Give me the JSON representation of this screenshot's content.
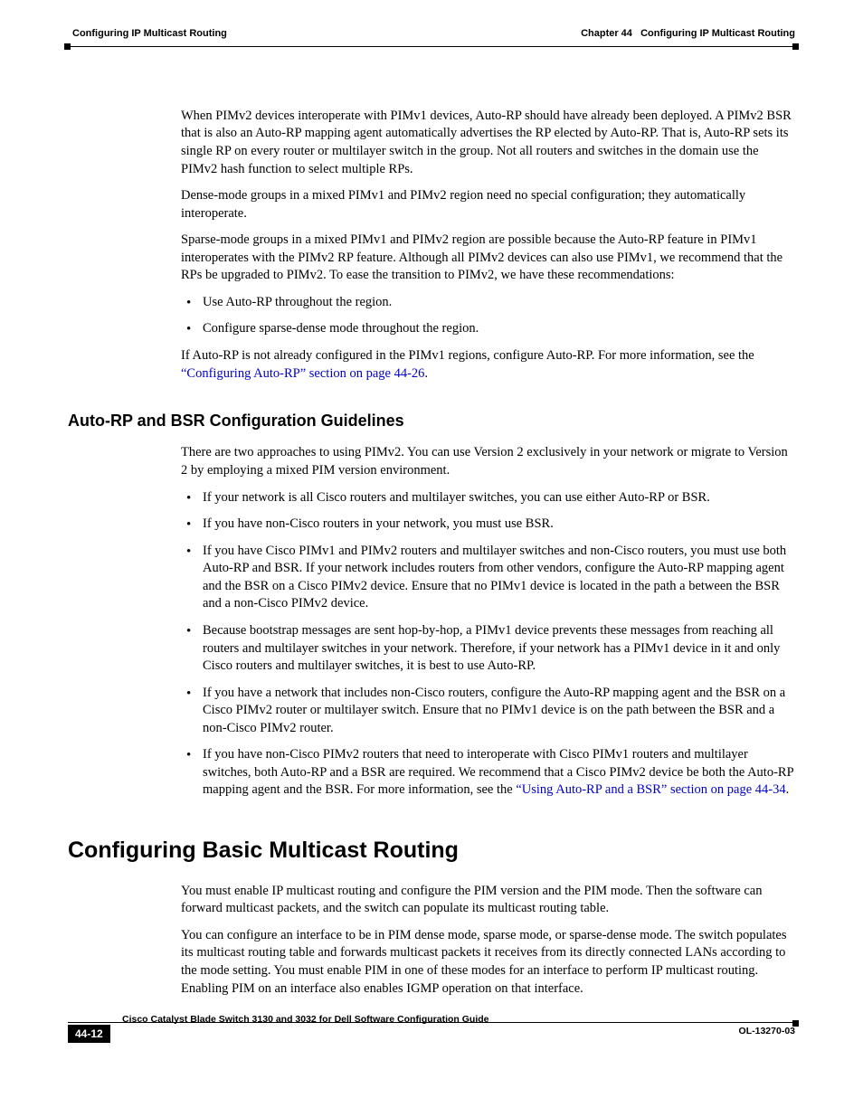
{
  "header": {
    "chapter_label": "Chapter 44",
    "chapter_title": "Configuring IP Multicast Routing",
    "section_running": "Configuring IP Multicast Routing"
  },
  "content": {
    "p1": "When PIMv2 devices interoperate with PIMv1 devices, Auto-RP should have already been deployed. A PIMv2 BSR that is also an Auto-RP mapping agent automatically advertises the RP elected by Auto-RP. That is, Auto-RP sets its single RP on every router or multilayer switch in the group. Not all routers and switches in the domain use the PIMv2 hash function to select multiple RPs.",
    "p2": "Dense-mode groups in a mixed PIMv1 and PIMv2 region need no special configuration; they automatically interoperate.",
    "p3": "Sparse-mode groups in a mixed PIMv1 and PIMv2 region are possible because the Auto-RP feature in PIMv1 interoperates with the PIMv2 RP feature. Although all PIMv2 devices can also use PIMv1, we recommend that the RPs be upgraded to PIMv2. To ease the transition to PIMv2, we have these recommendations:",
    "bullets1": [
      "Use Auto-RP throughout the region.",
      "Configure sparse-dense mode throughout the region."
    ],
    "p4_pre": "If Auto-RP is not already configured in the PIMv1 regions, configure Auto-RP. For more information, see the ",
    "p4_link": "“Configuring Auto-RP” section on page 44-26",
    "p4_post": ".",
    "h3": "Auto-RP and BSR Configuration Guidelines",
    "p5": "There are two approaches to using PIMv2. You can use Version 2 exclusively in your network or migrate to Version 2 by employing a mixed PIM version environment.",
    "bullets2": [
      "If your network is all Cisco routers and multilayer switches, you can use either Auto-RP or BSR.",
      "If you have non-Cisco routers in your network, you must use BSR.",
      "If you have Cisco PIMv1 and PIMv2 routers and multilayer switches and non-Cisco routers, you must use both Auto-RP and BSR. If your network includes routers from other vendors, configure the Auto-RP mapping agent and the BSR on a Cisco PIMv2 device. Ensure that no PIMv1 device is located in the path a between the BSR and a non-Cisco PIMv2 device.",
      "Because bootstrap messages are sent hop-by-hop, a PIMv1 device prevents these messages from reaching all routers and multilayer switches in your network. Therefore, if your network has a PIMv1 device in it and only Cisco routers and multilayer switches, it is best to use Auto-RP.",
      "If you have a network that includes non-Cisco routers, configure the Auto-RP mapping agent and the BSR on a Cisco PIMv2 router or multilayer switch. Ensure that no PIMv1 device is on the path between the BSR and a non-Cisco PIMv2 router."
    ],
    "bullet_last_pre": "If you have non-Cisco PIMv2 routers that need to interoperate with Cisco PIMv1 routers and multilayer switches, both Auto-RP and a BSR are required. We recommend that a Cisco PIMv2 device be both the Auto-RP mapping agent and the BSR. For more information, see the ",
    "bullet_last_link": "“Using Auto-RP and a BSR” section on page 44-34",
    "bullet_last_post": ".",
    "h2": "Configuring Basic Multicast Routing",
    "p6": "You must enable IP multicast routing and configure the PIM version and the PIM mode. Then the software can forward multicast packets, and the switch can populate its multicast routing table.",
    "p7": "You can configure an interface to be in PIM dense mode, sparse mode, or sparse-dense mode. The switch populates its multicast routing table and forwards multicast packets it receives from its directly connected LANs according to the mode setting. You must enable PIM in one of these modes for an interface to perform IP multicast routing. Enabling PIM on an interface also enables IGMP operation on that interface."
  },
  "footer": {
    "guide_title": "Cisco Catalyst Blade Switch 3130 and 3032 for Dell Software Configuration Guide",
    "page_number": "44-12",
    "doc_number": "OL-13270-03"
  }
}
